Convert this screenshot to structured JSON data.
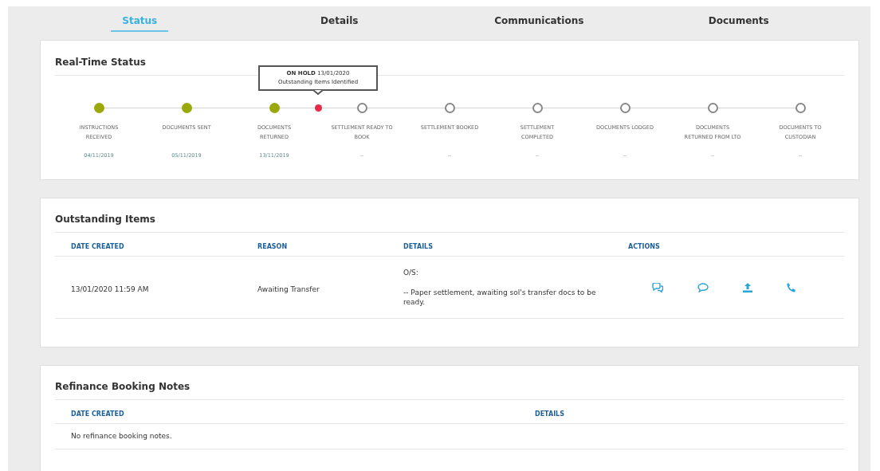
{
  "tabs": [
    {
      "label": "Status",
      "selected": true
    },
    {
      "label": "Details",
      "selected": false
    },
    {
      "label": "Communications",
      "selected": false
    },
    {
      "label": "Documents",
      "selected": false
    }
  ],
  "real_time_status": {
    "title": "Real-Time Status",
    "steps": [
      {
        "label": "INSTRUCTIONS RECEIVED",
        "date": "04/11/2019",
        "completed": true
      },
      {
        "label": "DOCUMENTS SENT",
        "date": "05/11/2019",
        "completed": true
      },
      {
        "label": "DOCUMENTS RETURNED",
        "date": "13/11/2019",
        "completed": true,
        "hold_after": {
          "line1": "**ON HOLD** 13/01/2020",
          "line2": "Outstanding Items Identified"
        }
      },
      {
        "label": "SETTLEMENT READY TO BOOK",
        "date": "--",
        "completed": false
      },
      {
        "label": "SETTLEMENT BOOKED",
        "date": "--",
        "completed": false
      },
      {
        "label": "SETTLEMENT COMPLETED",
        "date": "--",
        "completed": false
      },
      {
        "label": "DOCUMENTS LODGED",
        "date": "--",
        "completed": false
      },
      {
        "label": "DOCUMENTS RETURNED FROM LTO",
        "date": "--",
        "completed": false
      },
      {
        "label": "DOCUMENTS TO CUSTODIAN",
        "date": "--",
        "completed": false
      }
    ]
  },
  "outstanding_items": {
    "title": "Outstanding Items",
    "columns": [
      "DATE CREATED",
      "REASON",
      "DETAILS",
      "ACTIONS"
    ],
    "rows": [
      {
        "date_created": "13/01/2020 11:59 AM",
        "reason": "Awaiting Transfer",
        "details": [
          "O/S:",
          "-- Paper settlement, awaiting sol's transfer docs to be ready."
        ]
      }
    ]
  },
  "refinance_booking_notes": {
    "title": "Refinance Booking Notes",
    "columns": [
      "DATE CREATED",
      "DETAILS"
    ],
    "empty_message": "No refinance booking notes."
  }
}
